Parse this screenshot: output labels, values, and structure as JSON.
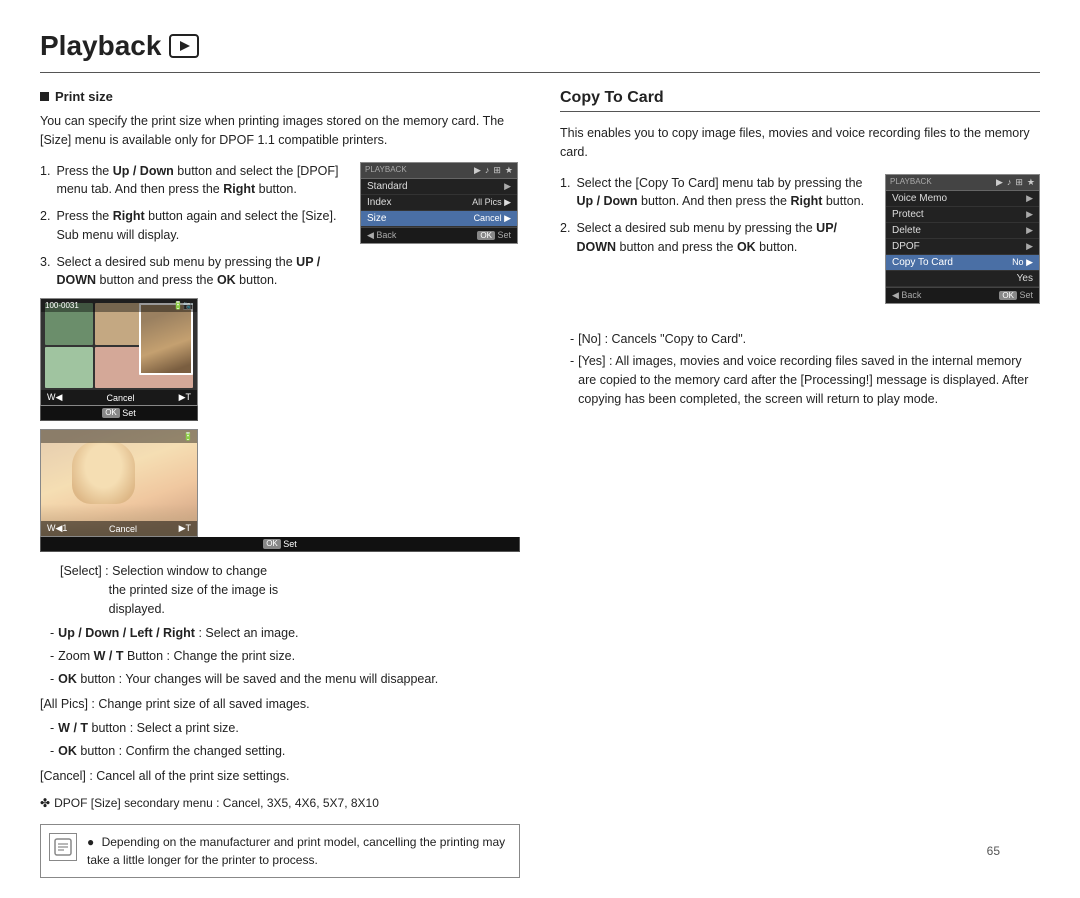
{
  "page": {
    "title": "Playback",
    "play_icon": "▶",
    "page_number": "65"
  },
  "left": {
    "print_size_label": "Print size",
    "intro": "You can specify the print size when printing images stored on the memory card. The [Size] menu is available only for DPOF 1.1 compatible printers.",
    "steps": [
      {
        "num": "1.",
        "text": "Press the Up / Down button and select the [DPOF] menu tab. And then press the Right button."
      },
      {
        "num": "2.",
        "text": "Press the Right button again and select the [Size]. Sub menu will display."
      },
      {
        "num": "3.",
        "text": "Select a desired sub menu by pressing the UP / DOWN button and press the OK button."
      }
    ],
    "select_label": "[Select] : Selection window to change",
    "select_sub": "the printed size of the image is displayed.",
    "sub_items": [
      "Up / Down / Left / Right : Select an image.",
      "Zoom W / T Button : Change the print size.",
      "OK button : Your changes will be saved and the menu will disappear."
    ],
    "all_pics": "[All Pics] : Change print size of all saved images.",
    "wt_button": "W / T button : Select a print size.",
    "ok_button": "OK button : Confirm the changed setting.",
    "cancel": "[Cancel] : Cancel all of the print size settings.",
    "dpof_note": "DPOF [Size] secondary menu : Cancel, 3X5, 4X6, 5X7, 8X10",
    "note_text": "Depending on the manufacturer and print model, cancelling the printing may take a little longer for the printer to process."
  },
  "menu1": {
    "header_label": "PLAYBACK",
    "icons": [
      "▶",
      "♪",
      "⊞",
      "★"
    ],
    "rows": [
      {
        "label": "Standard",
        "value": "▶",
        "selected": false
      },
      {
        "label": "Index",
        "value": "All Pics",
        "selected": false
      },
      {
        "label": "Size",
        "value": "Cancel",
        "selected": true
      }
    ],
    "footer_back": "◀ Back",
    "footer_ok": "OK",
    "footer_set": "Set"
  },
  "photo1": {
    "top_label": "100-0031",
    "top_icons": "📷",
    "cancel_label": "Cancel",
    "w_label": "W◀",
    "t_label": "▶T",
    "ok_label": "OK",
    "set_label": "Set"
  },
  "photo2": {
    "cancel_label": "Cancel",
    "w_label": "W◀1",
    "t_label": "▶T",
    "ok_label": "OK",
    "set_label": "Set"
  },
  "right": {
    "section_title": "Copy To Card",
    "intro": "This enables you to copy image files, movies and voice recording files to the memory card.",
    "steps": [
      {
        "num": "1.",
        "text": "Select the [Copy To Card] menu tab by pressing the Up / Down button. And then press the Right button."
      },
      {
        "num": "2.",
        "text": "Select a desired sub menu by pressing the UP/ DOWN button and press the OK button."
      }
    ],
    "no_label": "[No] : Cancels \"Copy to Card\".",
    "yes_label": "[Yes] : All images, movies and voice recording files saved in the internal memory are copied to the memory card after the [Processing!] message is displayed. After copying has been completed, the screen will return to play mode."
  },
  "menu2": {
    "header_label": "PLAYBACK",
    "icons": [
      "▶",
      "♪",
      "⊞",
      "★"
    ],
    "rows": [
      {
        "label": "Voice Memo",
        "value": "▶",
        "selected": false
      },
      {
        "label": "Protect",
        "value": "▶",
        "selected": false
      },
      {
        "label": "Delete",
        "value": "▶",
        "selected": false
      },
      {
        "label": "DPOF",
        "value": "▶",
        "selected": false
      },
      {
        "label": "Copy To Card",
        "value": "No",
        "selected": true
      },
      {
        "label": "",
        "value": "Yes",
        "selected": false
      }
    ],
    "footer_back": "◀ Back",
    "footer_ok": "OK",
    "footer_set": "Set"
  }
}
